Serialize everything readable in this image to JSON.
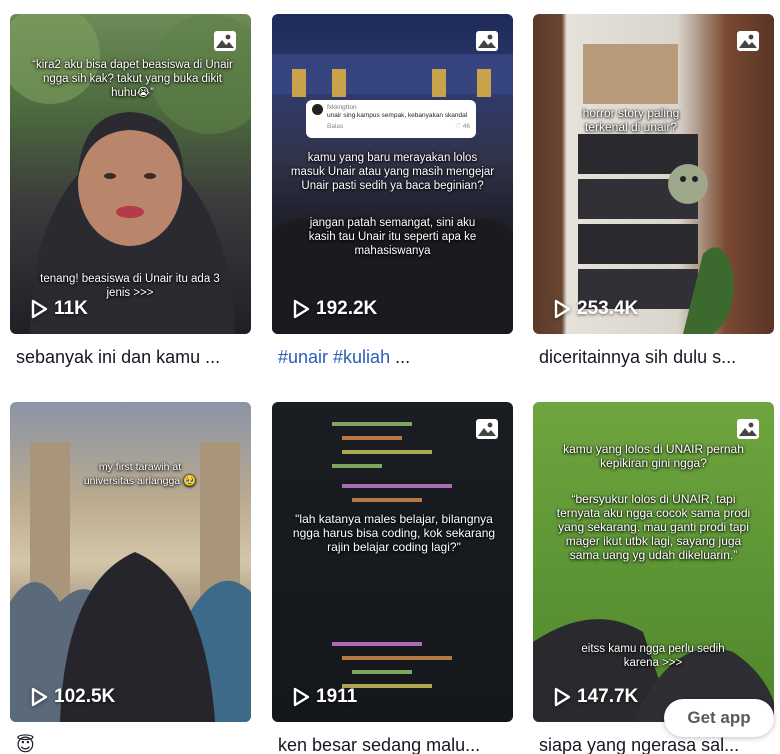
{
  "posts": [
    {
      "views": "11K",
      "caption": "sebanyak ini dan kamu ...",
      "overlay_top": "“kira2 aku bisa dapet beasiswa di Unair ngga sih kak? takut yang buka dikit huhu😭”",
      "overlay_bottom": "tenang! beasiswa di Unair itu ada 3 jenis >>>"
    },
    {
      "views": "192.2K",
      "caption_tags": "#unair #kuliah",
      "caption_suffix": " ...",
      "comment_user": "fxkkngtton",
      "comment_text": "unair sing kampus sempak, kebanyakan skandal",
      "comment_reply": "Balas",
      "comment_likes": "46",
      "overlay_text": "kamu yang baru merayakan lolos masuk Unair atau yang masih mengejar Unair pasti sedih ya baca beginian?",
      "overlay_text2": "jangan patah semangat, sini aku kasih tau Unair itu seperti apa ke mahasiswanya"
    },
    {
      "views": "253.4K",
      "caption": "diceritainnya sih dulu s...",
      "overlay_text": "horror story paling terkenal di unair?"
    },
    {
      "views": "102.5K",
      "caption": "😇",
      "overlay_text": "my first tarawih at universitas airlangga 🥹"
    },
    {
      "views": "1911",
      "caption": "ken besar sedang malu...",
      "overlay_text": "\"lah katanya males belajar, bilangnya ngga harus bisa coding, kok sekarang rajin belajar coding lagi?\""
    },
    {
      "views": "147.7K",
      "caption": "siapa yang ngerasa sal...",
      "overlay_text": "kamu yang lolos di UNAIR pernah kepikiran gini ngga?",
      "overlay_text2": "“bersyukur lolos di UNAIR, tapi ternyata aku ngga cocok sama prodi yang sekarang. mau ganti prodi tapi mager ikut utbk lagi, sayang juga sama uang yg udah dikeluarin.”",
      "overlay_text3": "eitss kamu ngga perlu sedih karena >>>"
    }
  ],
  "get_app_label": "Get app",
  "icons": {
    "views": "play-icon",
    "photo": "photo-icon"
  }
}
